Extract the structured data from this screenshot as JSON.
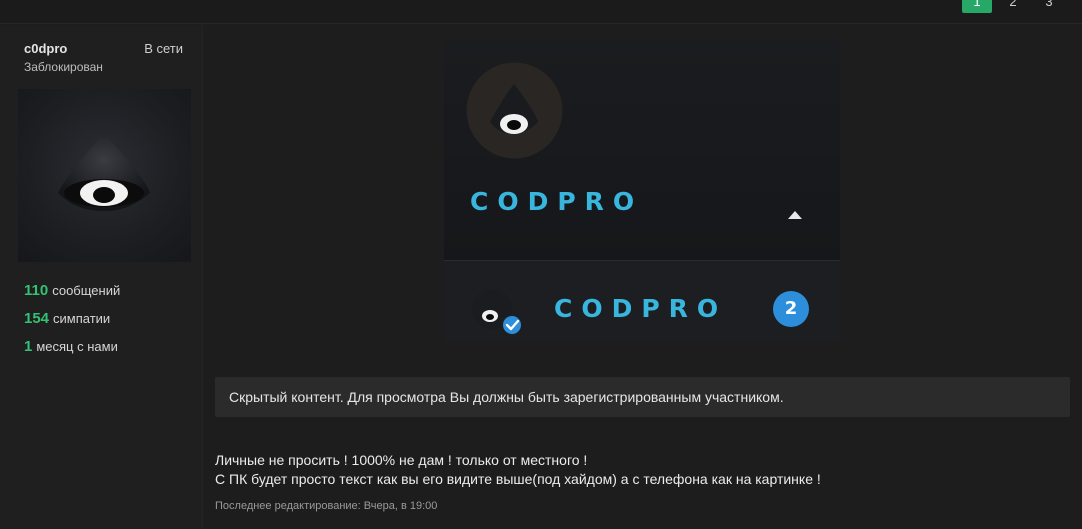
{
  "pagination": {
    "pages": [
      "1",
      "2",
      "3"
    ],
    "current": "1"
  },
  "user": {
    "username": "c0dpro",
    "online_status": "В сети",
    "role": "Заблокирован",
    "stats": [
      {
        "value": "110",
        "label": "сообщений"
      },
      {
        "value": "154",
        "label": "симпатии"
      },
      {
        "value": "1",
        "label": "месяц с нами"
      }
    ]
  },
  "post": {
    "image": {
      "brand_top": "CODPRO",
      "brand_bottom": "CODPRO",
      "notification_count": "2"
    },
    "hidden_notice": "Скрытый контент. Для просмотра Вы должны быть зарегистрированным участником.",
    "message_lines": [
      "Личные не просить ! 1000% не дам ! только от местного !",
      "С ПК будет просто текст как вы его видите выше(под хайдом) а с телефона как на картинке !"
    ],
    "last_edited": "Последнее редактирование: Вчера, в 19:00"
  },
  "colors": {
    "accent_green": "#27a867",
    "brand_blue": "#39b6dd",
    "badge_blue": "#2d8fdc"
  }
}
